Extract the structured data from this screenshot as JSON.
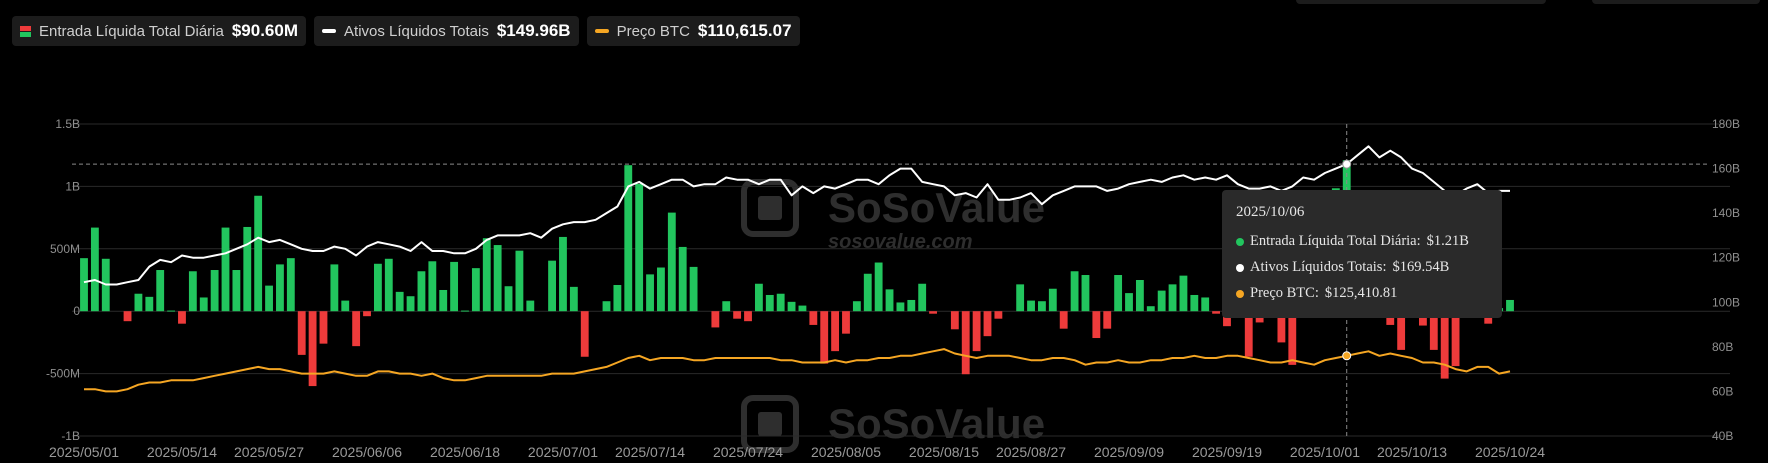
{
  "legend": {
    "flow_label": "Entrada Líquida Total Diária",
    "flow_value": "$90.60M",
    "assets_label": "Ativos Líquidos Totais",
    "assets_value": "$149.96B",
    "price_label": "Preço BTC",
    "price_value": "$110,615.07"
  },
  "colors": {
    "positive": "#22c55e",
    "negative": "#ee3b3b",
    "assets_line": "#ffffff",
    "price_line": "#f5a623",
    "grid": "#2a2a2a"
  },
  "watermark": {
    "brand": "SoSoValue",
    "site": "sosovalue.com"
  },
  "tooltip": {
    "date": "2025/10/06",
    "flow_label": "Entrada Líquida Total Diária:",
    "flow_value": "$1.21B",
    "assets_label": "Ativos Líquidos Totais:",
    "assets_value": "$169.54B",
    "price_label": "Preço BTC:",
    "price_value": "$125,410.81"
  },
  "chart_data": {
    "type": "bar",
    "left_axis": {
      "ticks": [
        "1.5B",
        "1B",
        "500M",
        "0",
        "-500M",
        "-1B"
      ],
      "ylim": [
        -1000,
        1500
      ],
      "unit": "M"
    },
    "right_axis": {
      "ticks": [
        "180B",
        "160B",
        "140B",
        "120B",
        "100B",
        "80B",
        "60B",
        "40B"
      ],
      "ylim": [
        40,
        180
      ],
      "unit": "B"
    },
    "x_ticks": [
      "2025/05/01",
      "2025/05/14",
      "2025/05/27",
      "2025/06/06",
      "2025/06/18",
      "2025/07/01",
      "2025/07/14",
      "2025/07/24",
      "2025/08/05",
      "2025/08/15",
      "2025/08/27",
      "2025/09/09",
      "2025/09/19",
      "2025/10/01",
      "2025/10/13",
      "2025/10/24"
    ],
    "series": [
      {
        "name": "Entrada Líquida Total Diária",
        "kind": "bar",
        "values": [
          425,
          670,
          420,
          0,
          -80,
          140,
          115,
          330,
          5,
          -100,
          320,
          110,
          330,
          670,
          330,
          675,
          925,
          205,
          375,
          425,
          -350,
          -600,
          -260,
          375,
          85,
          -280,
          -40,
          380,
          420,
          155,
          120,
          320,
          400,
          170,
          395,
          5,
          345,
          585,
          530,
          200,
          485,
          85,
          0,
          405,
          595,
          195,
          -365,
          0,
          80,
          210,
          1170,
          1020,
          295,
          350,
          790,
          515,
          355,
          0,
          -130,
          80,
          -60,
          -80,
          220,
          130,
          140,
          75,
          45,
          -110,
          -420,
          -320,
          -180,
          80,
          300,
          390,
          175,
          70,
          90,
          220,
          -20,
          0,
          -145,
          -505,
          -320,
          -200,
          -60,
          0,
          215,
          85,
          80,
          180,
          -140,
          320,
          290,
          -215,
          -140,
          290,
          145,
          250,
          40,
          165,
          215,
          285,
          130,
          110,
          -20,
          -120,
          200,
          -365,
          -90,
          240,
          -250,
          -430,
          0,
          425,
          645,
          985,
          1210,
          870,
          440,
          200,
          -110,
          -310,
          100,
          -115,
          -310,
          -540,
          -440,
          -30,
          470,
          -100,
          25,
          90
        ]
      },
      {
        "name": "Ativos Líquidos Totais",
        "kind": "line",
        "axis": "right",
        "values": [
          109,
          110,
          108,
          108,
          109,
          110,
          116,
          119,
          118,
          121,
          120,
          120,
          121,
          122,
          124,
          126,
          129,
          127,
          128,
          126,
          124,
          123,
          123,
          125,
          124,
          121,
          125,
          127,
          126,
          125,
          123,
          127,
          123,
          123,
          122,
          122,
          124,
          128,
          130,
          130,
          130,
          131,
          129,
          133,
          135,
          136,
          136,
          137,
          140,
          143,
          152,
          154,
          151,
          153,
          155,
          155,
          152,
          153,
          153,
          156,
          155,
          155,
          153,
          155,
          155,
          148,
          152,
          149,
          152,
          151,
          153,
          155,
          155,
          153,
          157,
          160,
          160,
          154,
          153,
          152,
          148,
          149,
          147,
          153,
          146,
          146,
          147,
          149,
          144,
          148,
          150,
          152,
          152,
          152,
          150,
          151,
          153,
          154,
          155,
          154,
          156,
          157,
          155,
          156,
          155,
          157,
          153,
          151,
          151,
          152,
          150,
          152,
          156,
          155,
          158,
          160,
          162,
          166,
          170,
          165,
          168,
          165,
          160,
          158,
          154,
          150,
          148,
          151,
          153,
          149,
          150,
          150
        ]
      },
      {
        "name": "Preço BTC",
        "kind": "line",
        "axis": "right",
        "values": [
          61,
          61,
          60,
          60,
          61,
          63,
          64,
          64,
          65,
          65,
          65,
          66,
          67,
          68,
          69,
          70,
          71,
          70,
          70,
          69,
          68,
          68,
          68,
          69,
          68,
          67,
          67,
          69,
          69,
          68,
          68,
          67,
          68,
          66,
          65,
          65,
          66,
          67,
          67,
          67,
          67,
          67,
          67,
          68,
          68,
          68,
          69,
          70,
          71,
          73,
          75,
          76,
          74,
          75,
          75,
          75,
          74,
          74,
          75,
          75,
          75,
          75,
          75,
          75,
          74,
          74,
          73,
          73,
          73,
          74,
          73,
          74,
          74,
          75,
          75,
          76,
          76,
          77,
          78,
          79,
          77,
          76,
          75,
          76,
          76,
          76,
          75,
          74,
          74,
          75,
          75,
          74,
          72,
          73,
          73,
          74,
          73,
          73,
          74,
          74,
          75,
          75,
          76,
          75,
          75,
          76,
          76,
          75,
          74,
          73,
          73,
          74,
          73,
          72,
          74,
          75,
          76,
          77,
          78,
          76,
          77,
          76,
          75,
          73,
          73,
          72,
          70,
          69,
          71,
          71,
          68,
          69
        ]
      }
    ],
    "highlight_index": 116
  }
}
